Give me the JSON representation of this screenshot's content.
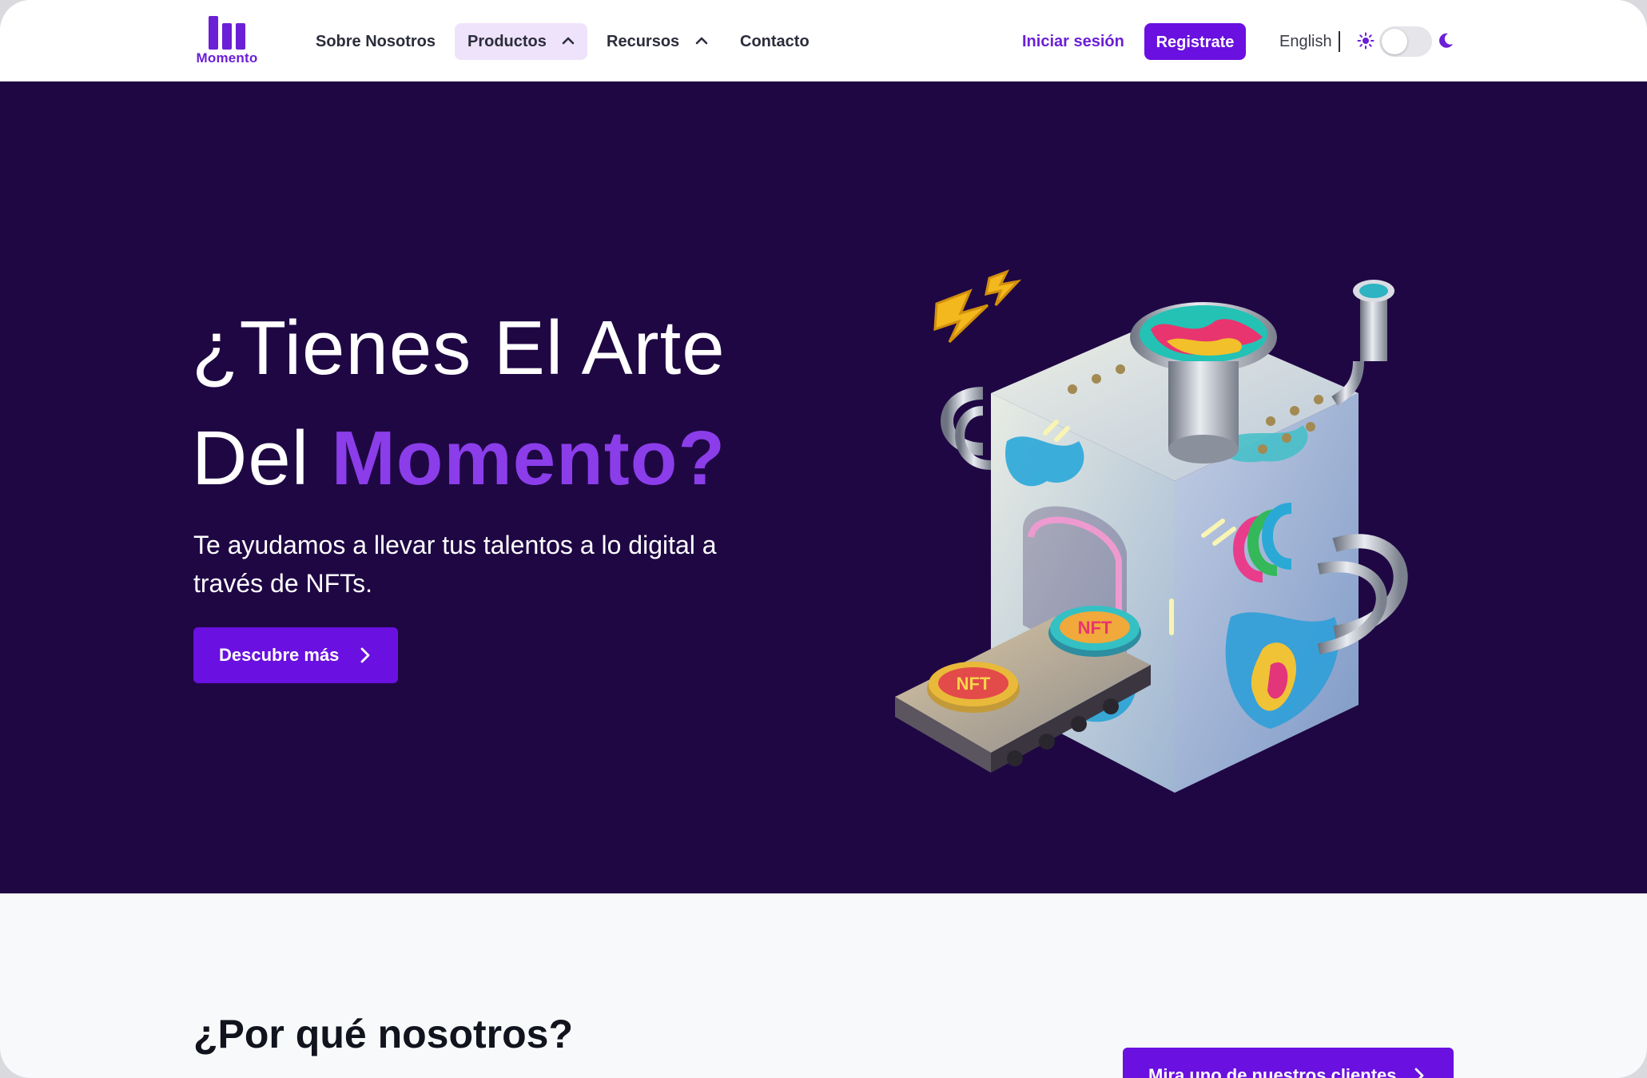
{
  "brand": {
    "name": "Momento",
    "color": "#6b1fd6"
  },
  "nav": {
    "items": [
      {
        "label": "Sobre Nosotros"
      },
      {
        "label": "Productos"
      },
      {
        "label": "Recursos"
      },
      {
        "label": "Contacto"
      }
    ],
    "login_label": "Iniciar sesión",
    "signup_label": "Registrate",
    "language_label": "English",
    "theme_toggle": {
      "light_icon": "sun-icon",
      "dark_icon": "moon-icon",
      "dark_mode": false
    }
  },
  "hero": {
    "title_line1": "¿Tienes El Arte",
    "title_line2_prefix": "Del ",
    "title_line2_accent": "Momento?",
    "subtitle": "Te ayudamos a llevar tus talentos a lo digital a través de NFTs.",
    "cta_label": "Descubre más",
    "illustration_label": "NFT",
    "background": "#1f0744",
    "accent_color": "#8b3dea"
  },
  "why": {
    "title": "¿Por qué nosotros?",
    "cta_label": "Mira uno de nuestros clientes"
  },
  "colors": {
    "primary": "#6a10e0",
    "page_bg": "#f8f9fb"
  }
}
